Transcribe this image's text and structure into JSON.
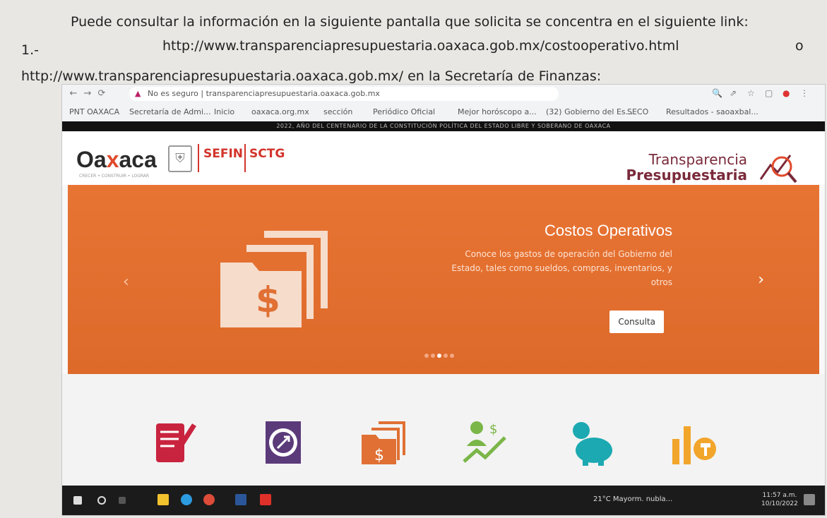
{
  "document": {
    "line1": "Puede consultar la información en la siguiente pantalla que solicita se concentra en el siguiente link:",
    "number": "1.-",
    "link1": "http://www.transparenciapresupuestaria.oaxaca.gob.mx/costooperativo.html",
    "or": "o",
    "line3": "http://www.transparenciapresupuestaria.oaxaca.gob.mx/ en la Secretaría de Finanzas:"
  },
  "browser": {
    "address": "transparenciapresupuestaria.oaxaca.gob.mx",
    "security": "No es seguro",
    "bookmarks": [
      "PNT OAXACA",
      "Secretaría de Admi...",
      "Inicio",
      "oaxaca.org.mx",
      "sección",
      "Periódico Oficial",
      "Mejor horóscopo a...",
      "(32) Gobierno del Es...",
      "SECO",
      "Resultados - saoaxbal..."
    ]
  },
  "banner": "2022, AÑO DEL CENTENARIO DE LA CONSTITUCIÓN POLÍTICA DEL ESTADO LIBRE Y SOBERANO DE OAXACA",
  "header": {
    "oaxaca_logo_a": "Oa",
    "oaxaca_logo_x": "x",
    "oaxaca_logo_b": "aca",
    "oaxaca_tagline": "CRECER • CONSTRUIR • LOGRAR",
    "sefin": "SEFIN",
    "sctg": "SCTG",
    "tp_title": "Transparencia",
    "tp_sub": "Presupuestaria"
  },
  "carousel": {
    "title": "Costos Operativos",
    "description": "Conoce los gastos de operación del Gobierno del Estado, tales como sueldos, compras, inventarios, y otros",
    "button": "Consulta",
    "prev": "‹",
    "next": "›"
  },
  "taskbar": {
    "weather": "21°C  Mayorm. nubla...",
    "time": "11:57 a.m.",
    "date": "10/10/2022"
  },
  "colors": {
    "accent_orange": "#e87434",
    "brand_red": "#d2342b",
    "tp_maroon": "#7a2a3a"
  }
}
